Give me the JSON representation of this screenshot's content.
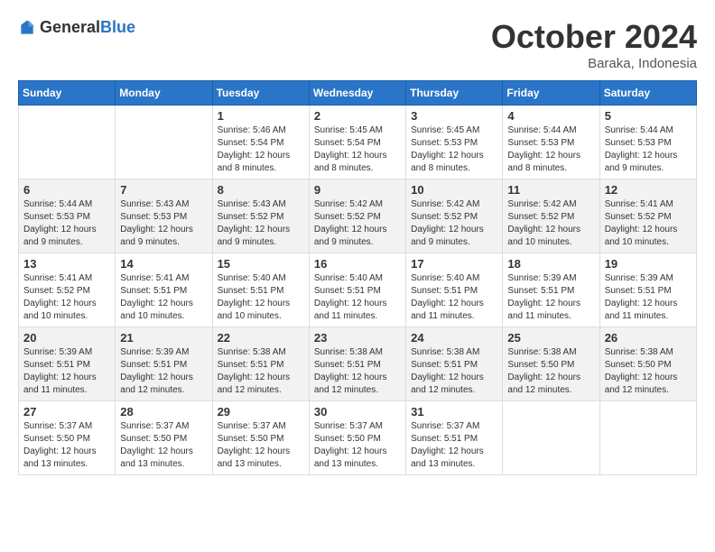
{
  "logo": {
    "general": "General",
    "blue": "Blue"
  },
  "title": "October 2024",
  "subtitle": "Baraka, Indonesia",
  "days_header": [
    "Sunday",
    "Monday",
    "Tuesday",
    "Wednesday",
    "Thursday",
    "Friday",
    "Saturday"
  ],
  "weeks": [
    [
      {
        "day": "",
        "info": ""
      },
      {
        "day": "",
        "info": ""
      },
      {
        "day": "1",
        "info": "Sunrise: 5:46 AM\nSunset: 5:54 PM\nDaylight: 12 hours and 8 minutes."
      },
      {
        "day": "2",
        "info": "Sunrise: 5:45 AM\nSunset: 5:54 PM\nDaylight: 12 hours and 8 minutes."
      },
      {
        "day": "3",
        "info": "Sunrise: 5:45 AM\nSunset: 5:53 PM\nDaylight: 12 hours and 8 minutes."
      },
      {
        "day": "4",
        "info": "Sunrise: 5:44 AM\nSunset: 5:53 PM\nDaylight: 12 hours and 8 minutes."
      },
      {
        "day": "5",
        "info": "Sunrise: 5:44 AM\nSunset: 5:53 PM\nDaylight: 12 hours and 9 minutes."
      }
    ],
    [
      {
        "day": "6",
        "info": "Sunrise: 5:44 AM\nSunset: 5:53 PM\nDaylight: 12 hours and 9 minutes."
      },
      {
        "day": "7",
        "info": "Sunrise: 5:43 AM\nSunset: 5:53 PM\nDaylight: 12 hours and 9 minutes."
      },
      {
        "day": "8",
        "info": "Sunrise: 5:43 AM\nSunset: 5:52 PM\nDaylight: 12 hours and 9 minutes."
      },
      {
        "day": "9",
        "info": "Sunrise: 5:42 AM\nSunset: 5:52 PM\nDaylight: 12 hours and 9 minutes."
      },
      {
        "day": "10",
        "info": "Sunrise: 5:42 AM\nSunset: 5:52 PM\nDaylight: 12 hours and 9 minutes."
      },
      {
        "day": "11",
        "info": "Sunrise: 5:42 AM\nSunset: 5:52 PM\nDaylight: 12 hours and 10 minutes."
      },
      {
        "day": "12",
        "info": "Sunrise: 5:41 AM\nSunset: 5:52 PM\nDaylight: 12 hours and 10 minutes."
      }
    ],
    [
      {
        "day": "13",
        "info": "Sunrise: 5:41 AM\nSunset: 5:52 PM\nDaylight: 12 hours and 10 minutes."
      },
      {
        "day": "14",
        "info": "Sunrise: 5:41 AM\nSunset: 5:51 PM\nDaylight: 12 hours and 10 minutes."
      },
      {
        "day": "15",
        "info": "Sunrise: 5:40 AM\nSunset: 5:51 PM\nDaylight: 12 hours and 10 minutes."
      },
      {
        "day": "16",
        "info": "Sunrise: 5:40 AM\nSunset: 5:51 PM\nDaylight: 12 hours and 11 minutes."
      },
      {
        "day": "17",
        "info": "Sunrise: 5:40 AM\nSunset: 5:51 PM\nDaylight: 12 hours and 11 minutes."
      },
      {
        "day": "18",
        "info": "Sunrise: 5:39 AM\nSunset: 5:51 PM\nDaylight: 12 hours and 11 minutes."
      },
      {
        "day": "19",
        "info": "Sunrise: 5:39 AM\nSunset: 5:51 PM\nDaylight: 12 hours and 11 minutes."
      }
    ],
    [
      {
        "day": "20",
        "info": "Sunrise: 5:39 AM\nSunset: 5:51 PM\nDaylight: 12 hours and 11 minutes."
      },
      {
        "day": "21",
        "info": "Sunrise: 5:39 AM\nSunset: 5:51 PM\nDaylight: 12 hours and 12 minutes."
      },
      {
        "day": "22",
        "info": "Sunrise: 5:38 AM\nSunset: 5:51 PM\nDaylight: 12 hours and 12 minutes."
      },
      {
        "day": "23",
        "info": "Sunrise: 5:38 AM\nSunset: 5:51 PM\nDaylight: 12 hours and 12 minutes."
      },
      {
        "day": "24",
        "info": "Sunrise: 5:38 AM\nSunset: 5:51 PM\nDaylight: 12 hours and 12 minutes."
      },
      {
        "day": "25",
        "info": "Sunrise: 5:38 AM\nSunset: 5:50 PM\nDaylight: 12 hours and 12 minutes."
      },
      {
        "day": "26",
        "info": "Sunrise: 5:38 AM\nSunset: 5:50 PM\nDaylight: 12 hours and 12 minutes."
      }
    ],
    [
      {
        "day": "27",
        "info": "Sunrise: 5:37 AM\nSunset: 5:50 PM\nDaylight: 12 hours and 13 minutes."
      },
      {
        "day": "28",
        "info": "Sunrise: 5:37 AM\nSunset: 5:50 PM\nDaylight: 12 hours and 13 minutes."
      },
      {
        "day": "29",
        "info": "Sunrise: 5:37 AM\nSunset: 5:50 PM\nDaylight: 12 hours and 13 minutes."
      },
      {
        "day": "30",
        "info": "Sunrise: 5:37 AM\nSunset: 5:50 PM\nDaylight: 12 hours and 13 minutes."
      },
      {
        "day": "31",
        "info": "Sunrise: 5:37 AM\nSunset: 5:51 PM\nDaylight: 12 hours and 13 minutes."
      },
      {
        "day": "",
        "info": ""
      },
      {
        "day": "",
        "info": ""
      }
    ]
  ]
}
